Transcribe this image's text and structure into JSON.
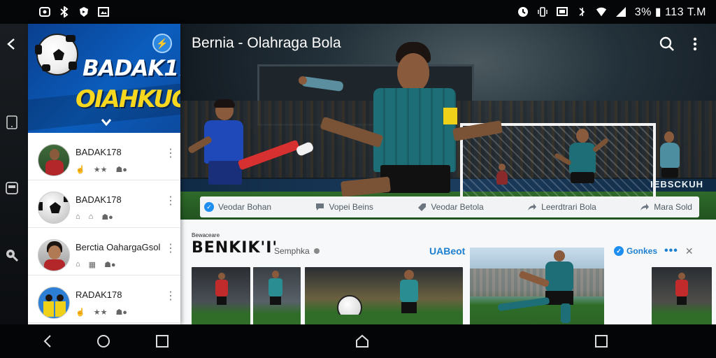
{
  "status_bar": {
    "right_text": "3% ▮ 113 T.M",
    "left_icons": [
      "link-icon",
      "bluetooth-icon",
      "shield-icon",
      "gallery-icon"
    ],
    "right_icons": [
      "alarm-icon",
      "vibrate-icon",
      "cast-icon",
      "sync-icon",
      "wifi-icon",
      "signal-icon"
    ]
  },
  "app_bar": {
    "title": "Bernia - Olahraga Bola",
    "actions": [
      "search-icon",
      "more-vert-icon"
    ]
  },
  "hero": {
    "ad_text": "IEBSCKUH"
  },
  "action_bar": {
    "items": [
      {
        "label": "Veodar Bohan",
        "icon": "verified-icon"
      },
      {
        "label": "Vopei Beins",
        "icon": "comment-icon"
      },
      {
        "label": "Veodar Betola",
        "icon": "tag-icon"
      },
      {
        "label": "Leerdtrari Bola",
        "icon": "share-icon"
      },
      {
        "label": "Mara Sold",
        "icon": "forward-icon"
      }
    ]
  },
  "lower": {
    "brand_small": "Bewaceare",
    "brand_big": "BENKIK'I'",
    "brand_sub": "Semphka",
    "link": "UABeot",
    "right_label": "Gonkes"
  },
  "drawer": {
    "header": {
      "title_line1": "BADAK178",
      "title_line2": "OIAHKUGA"
    },
    "items": [
      {
        "name": "BADAK178"
      },
      {
        "name": "BADAK178"
      },
      {
        "name": "Berctia OahargaGsol"
      },
      {
        "name": "RADAK178"
      }
    ]
  },
  "colors": {
    "drawer_header": "#0b5dbd",
    "accent_yellow": "#f7d81f",
    "link_blue": "#1d7fd0",
    "jersey_teal": "#1e6e78",
    "jersey_blue": "#1f49b8"
  }
}
